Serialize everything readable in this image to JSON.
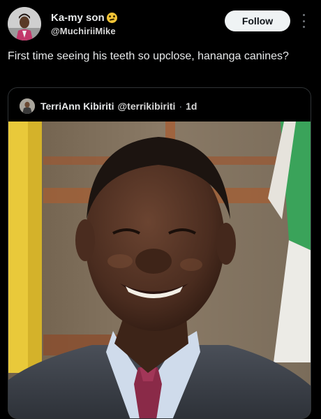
{
  "tweet": {
    "author": {
      "display_name": "Ka-my son",
      "emoji": "zany-face-emoji",
      "handle": "@MuchiriiMike",
      "avatar": "avatar-photo"
    },
    "follow_label": "Follow",
    "more_icon": "more-vertical-icon",
    "text": "First time seeing his teeth so upclose, hananga canines?"
  },
  "quoted_tweet": {
    "author": {
      "display_name": "TerriAnn Kibiriti",
      "handle": "@terrikibiriti",
      "separator": "·",
      "time": "1d",
      "avatar": "avatar-photo"
    },
    "media": "photo"
  },
  "colors": {
    "background": "#000000",
    "text_primary": "#e7e9ea",
    "text_secondary": "#71767b",
    "border": "#2f3336",
    "follow_bg": "#eff3f4",
    "follow_text": "#0f1419"
  }
}
